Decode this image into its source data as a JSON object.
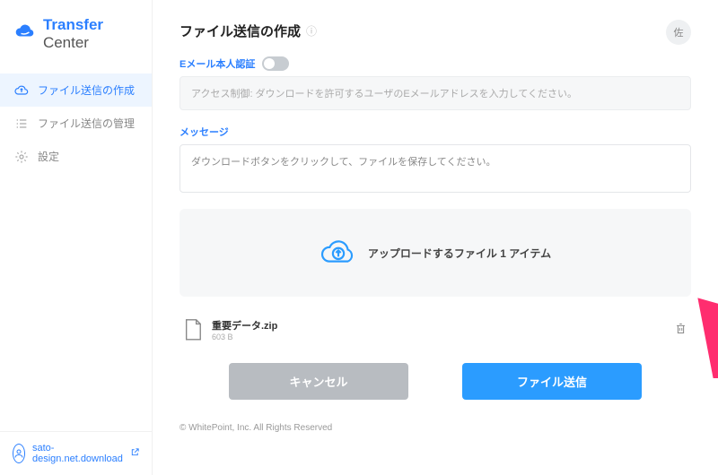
{
  "brand": {
    "name1": "Transfer",
    "name2": "Center"
  },
  "sidebar": {
    "items": [
      {
        "label": "ファイル送信の作成"
      },
      {
        "label": "ファイル送信の管理"
      },
      {
        "label": "設定"
      }
    ]
  },
  "user": {
    "domain": "sato-design.net.download"
  },
  "header": {
    "title": "ファイル送信の作成",
    "avatar_initial": "佐"
  },
  "email_auth": {
    "label": "Eメール本人認証",
    "placeholder": "アクセス制御: ダウンロードを許可するユーザのEメールアドレスを入力してください。"
  },
  "message": {
    "label": "メッセージ",
    "value": "ダウンロードボタンをクリックして、ファイルを保存してください。"
  },
  "upload": {
    "text": "アップロードするファイル 1 アイテム"
  },
  "file": {
    "name": "重要データ.zip",
    "size": "603 B"
  },
  "buttons": {
    "cancel": "キャンセル",
    "submit": "ファイル送信"
  },
  "footer": {
    "copyright": "© WhitePoint, Inc. All Rights Reserved"
  }
}
